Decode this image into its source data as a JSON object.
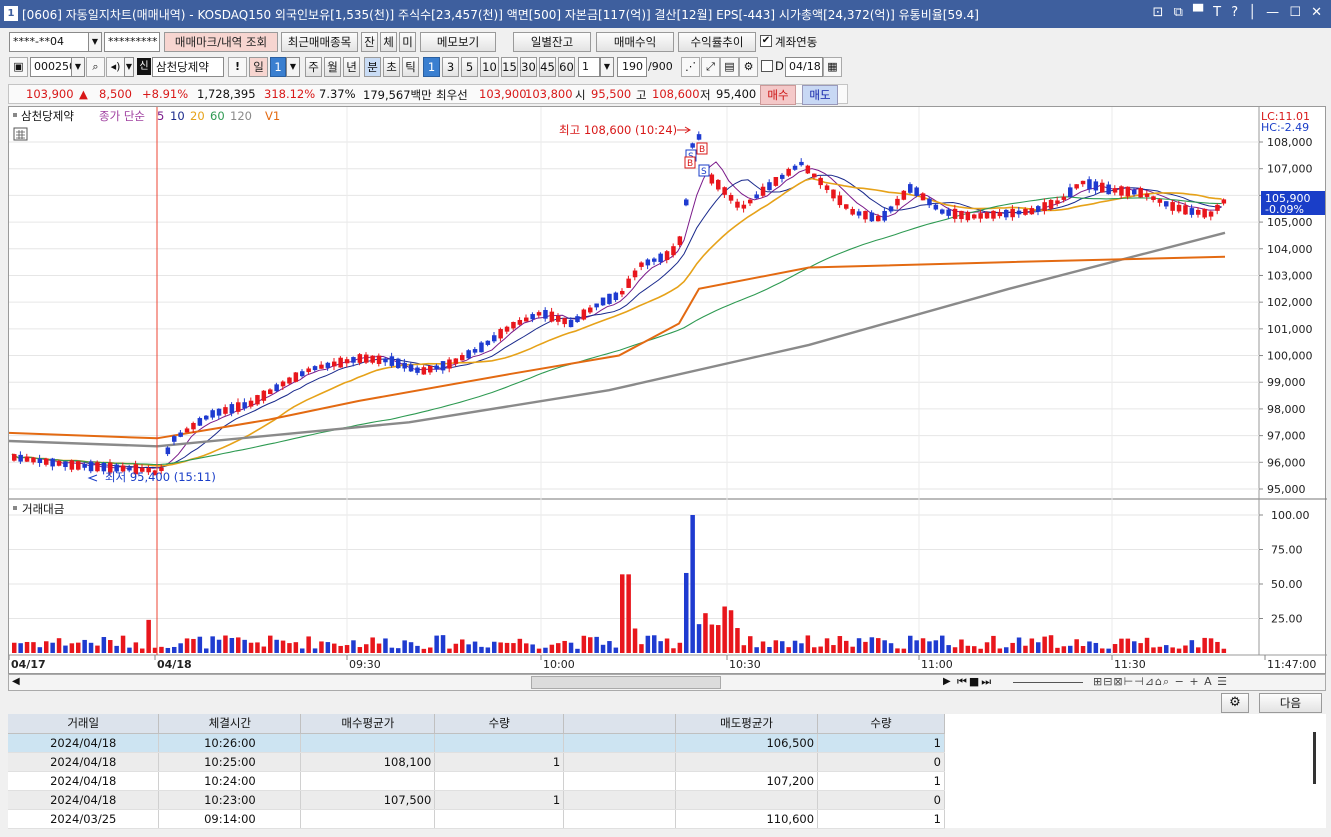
{
  "window": {
    "number": "1",
    "title": "[0606] 자동일지차트(매매내역) - KOSDAQ150 외국인보유[1,535(천)] 주식수[23,457(천)] 액면[500] 자본금[117(억)] 결산[12월] EPS[-443] 시가총액[24,372(억)] 유통비율[59.4]",
    "controls": "⊡ ⧉ ▀ T ? │ — ☐ ✕"
  },
  "toolbar1": {
    "account": "****-**04",
    "password": "*********",
    "b1": "매매마크/내역 조회",
    "b2": "최근매매종목",
    "b3": "잔",
    "b4": "체",
    "b5": "미",
    "b6": "메모보기",
    "b7": "일별잔고",
    "b8": "매매수익",
    "b9": "수익률추이",
    "check_label": "계좌연동"
  },
  "toolbar2": {
    "code": "000250",
    "stock": "삼천당제약",
    "p_day": "일",
    "p_day_num": "1",
    "p_week": "주",
    "p_month": "월",
    "p_year": "년",
    "p_min": "분",
    "p_sec": "초",
    "p_tick": "틱",
    "m1": "1",
    "m3": "3",
    "m5": "5",
    "m10": "10",
    "m15": "15",
    "m30": "30",
    "m45": "45",
    "m60": "60",
    "sel": "1",
    "count": "190",
    "count_max": "/900",
    "d_label": "D",
    "date": "04/18"
  },
  "quote": {
    "price": "103,900",
    "arrow": "▲",
    "change": "8,500",
    "pct": "+8.91%",
    "volume": "1,728,395",
    "vol_ratio": "318.12%",
    "turnover": "7.37%",
    "amount": "179,567백만",
    "best_label": "최우선",
    "ask": "103,900",
    "bid": "103,800",
    "open_label": "시",
    "open": "95,500",
    "high_label": "고",
    "high": "108,600",
    "low_label": "저",
    "low": "95,400",
    "buy_btn": "매수",
    "sell_btn": "매도"
  },
  "chart": {
    "legend": {
      "name": "삼천당제약",
      "type": "종가 단순",
      "ma5": "5",
      "ma10": "10",
      "ma20": "20",
      "ma60": "60",
      "ma120": "120",
      "v1": "V1"
    },
    "lc": "LC:11.01",
    "hc": "HC:-2.49",
    "price_tag": "105,900",
    "price_pct": "-0.09%",
    "high_annot": "최고 108,600 (10:24)",
    "low_annot": "최저 95,400 (15:11)",
    "vol_title": "거래대금",
    "price_axis": [
      "108,000",
      "107,000",
      "106,000",
      "105,000",
      "104,000",
      "103,000",
      "102,000",
      "101,000",
      "100,000",
      "99,000",
      "98,000",
      "97,000",
      "96,000",
      "95,000"
    ],
    "vol_axis": [
      "100.00",
      "75.00",
      "50.00",
      "25.00"
    ],
    "time_axis": [
      "04/17",
      "04/18",
      "09:30",
      "10:00",
      "10:30",
      "11:00",
      "11:30",
      "11:47:00"
    ],
    "colors": {
      "up": "#e8161c",
      "down": "#1f3bd0",
      "ma5": "#7a1a8a",
      "ma10": "#1a2a8c",
      "ma20": "#e6a219",
      "ma60": "#2e9a52",
      "ma120": "#8a8a8a",
      "v1": "#e36a12"
    }
  },
  "chart_data": {
    "type": "candlestick",
    "symbol": "삼천당제약",
    "ylim": [
      95000,
      108600
    ],
    "open": 95500,
    "high": 108600,
    "low": 95400,
    "close": 103900,
    "vol_ylim": [
      0,
      100
    ]
  },
  "table": {
    "headers": [
      "거래일",
      "체결시간",
      "매수평균가",
      "수량",
      "",
      "매도평균가",
      "수량"
    ],
    "rows": [
      [
        "2024/04/18",
        "10:26:00",
        "",
        "",
        "",
        "106,500",
        "1"
      ],
      [
        "2024/04/18",
        "10:25:00",
        "108,100",
        "1",
        "",
        "",
        "0"
      ],
      [
        "2024/04/18",
        "10:24:00",
        "",
        "",
        "",
        "107,200",
        "1"
      ],
      [
        "2024/04/18",
        "10:23:00",
        "107,500",
        "1",
        "",
        "",
        "0"
      ],
      [
        "2024/03/25",
        "09:14:00",
        "",
        "",
        "",
        "110,600",
        "1"
      ]
    ]
  },
  "next_btn": "다음"
}
